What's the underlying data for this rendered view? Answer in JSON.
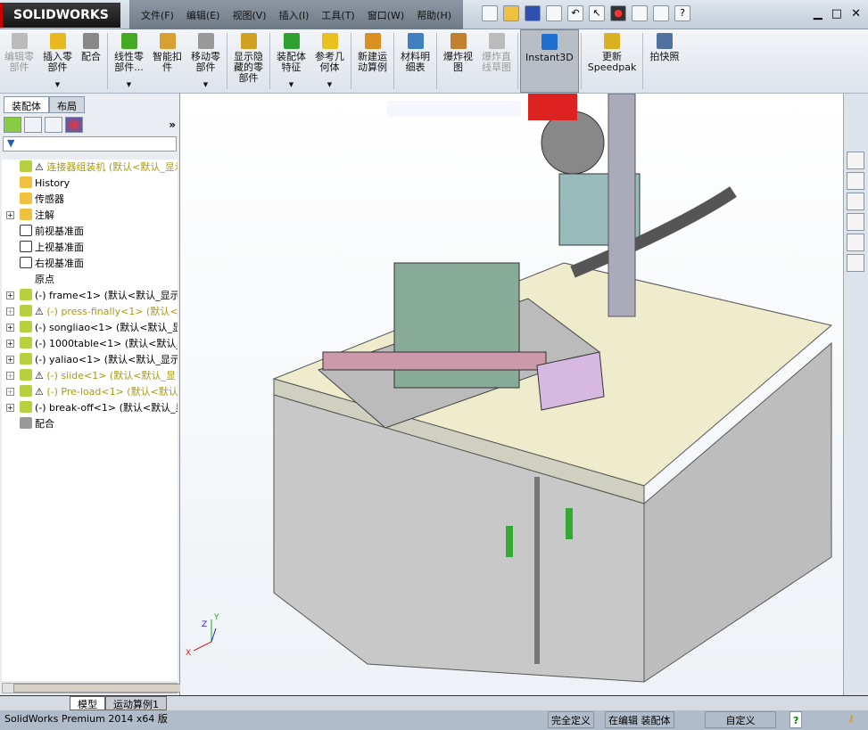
{
  "app": {
    "logo": "SOLIDWORKS",
    "menus": [
      "文件(F)",
      "编辑(E)",
      "视图(V)",
      "插入(I)",
      "工具(T)",
      "窗口(W)",
      "帮助(H)"
    ]
  },
  "ribbon": [
    {
      "label": "编辑零\n部件",
      "disabled": true,
      "color": "#bbbbbb"
    },
    {
      "label": "插入零\n部件",
      "dropdown": true,
      "color": "#e8b820"
    },
    {
      "label": "配合",
      "color": "#888888"
    },
    {
      "label": "线性零\n部件...",
      "dropdown": true,
      "color": "#44aa22"
    },
    {
      "label": "智能扣\n件",
      "color": "#d8a030"
    },
    {
      "label": "移动零\n部件",
      "dropdown": true,
      "color": "#999999"
    },
    {
      "label": "显示隐\n藏的零\n部件",
      "color": "#d0a020"
    },
    {
      "label": "装配体\n特征",
      "dropdown": true,
      "color": "#30a030"
    },
    {
      "label": "参考几\n何体",
      "dropdown": true,
      "color": "#e8c020"
    },
    {
      "label": "新建运\n动算例",
      "color": "#d89020"
    },
    {
      "label": "材料明\n细表",
      "color": "#4080c0"
    },
    {
      "label": "爆炸视\n图",
      "color": "#c08030"
    },
    {
      "label": "爆炸直\n线草图",
      "disabled": true,
      "color": "#bbbbbb"
    },
    {
      "label": "Instant3D",
      "active": true,
      "color": "#2070d0"
    },
    {
      "label": "更新\nSpeedpak",
      "color": "#d8b020"
    },
    {
      "label": "拍快照",
      "color": "#5070a0"
    }
  ],
  "left_panel": {
    "tabs": [
      "装配体",
      "布局"
    ],
    "active_tab": "装配体",
    "tree": [
      {
        "label": "连接器组装机 (默认<默认_显示",
        "warn": true,
        "icon": "assembly-icon",
        "expand": false
      },
      {
        "label": "History",
        "icon": "history-folder-icon"
      },
      {
        "label": "传感器",
        "icon": "sensor-folder-icon"
      },
      {
        "label": "注解",
        "icon": "annotation-icon",
        "expand": true
      },
      {
        "label": "前视基准面",
        "icon": "plane-icon"
      },
      {
        "label": "上视基准面",
        "icon": "plane-icon"
      },
      {
        "label": "右视基准面",
        "icon": "plane-icon"
      },
      {
        "label": "原点",
        "icon": "origin-icon"
      },
      {
        "label": "(-) frame<1> (默认<默认_显示",
        "icon": "assembly-icon",
        "expand": true
      },
      {
        "label": "(-) press-finally<1> (默认<默",
        "icon": "assembly-icon",
        "expand": true,
        "warn": true
      },
      {
        "label": "(-) songliao<1> (默认<默认_显",
        "icon": "assembly-icon",
        "expand": true
      },
      {
        "label": "(-) 1000table<1> (默认<默认_显",
        "icon": "assembly-icon",
        "expand": true
      },
      {
        "label": "(-) yaliao<1> (默认<默认_显示",
        "icon": "assembly-icon",
        "expand": true
      },
      {
        "label": "(-) slide<1> (默认<默认_显",
        "icon": "assembly-icon",
        "expand": true,
        "warn": true
      },
      {
        "label": "(-) Pre-load<1> (默认<默认",
        "icon": "assembly-icon",
        "expand": true,
        "warn": true
      },
      {
        "label": "(-) break-off<1> (默认<默认_显",
        "icon": "assembly-icon",
        "expand": true
      },
      {
        "label": "配合",
        "icon": "mates-icon"
      }
    ]
  },
  "bottom_tabs": [
    "模型",
    "运动算例1"
  ],
  "status": {
    "product": "SolidWorks Premium 2014 x64 版",
    "definition": "完全定义",
    "editing": "在编辑 装配体",
    "units": "自定义"
  },
  "triad": {
    "x": "X",
    "y": "Y",
    "z": "Z"
  }
}
